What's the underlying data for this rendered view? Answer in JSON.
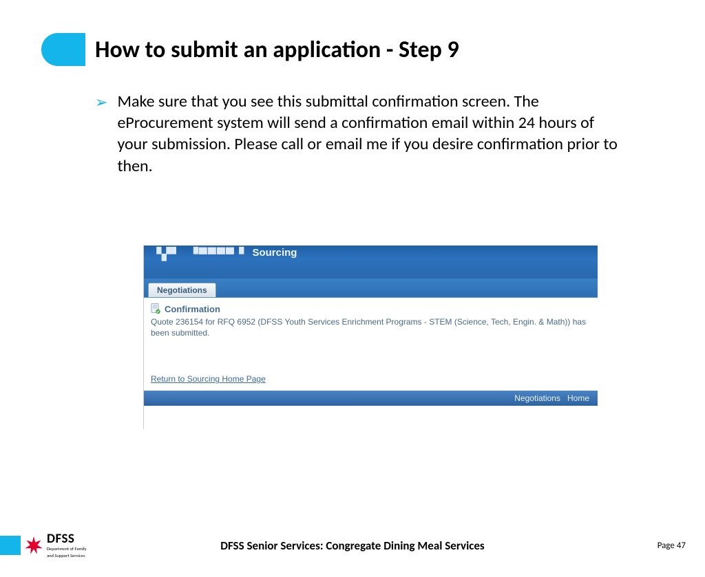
{
  "header": {
    "title": "How to submit an application - Step 9"
  },
  "bullet": {
    "text": "Make sure that you see this submittal confirmation screen. The eProcurement system will send a confirmation email within 24 hours of your submission. Please call or email me if you desire confirmation prior to then."
  },
  "screenshot": {
    "topbar_sourcing": "Sourcing",
    "tab_label": "Negotiations",
    "confirm_heading": "Confirmation",
    "confirm_text": "Quote 236154 for RFQ 6952 (DFSS Youth Services Enrichment Programs - STEM (Science, Tech, Engin. & Math)) has been submitted.",
    "return_link": "Return to Sourcing Home Page",
    "bottom_nav_negotiations": "Negotiations",
    "bottom_nav_home": "Home"
  },
  "footer": {
    "logo_main": "DFSS",
    "logo_sub1": "Department of Family",
    "logo_sub2": "and Support Services",
    "center_title": "DFSS Senior Services: Congregate Dining Meal Services",
    "page_label": "Page 47"
  }
}
